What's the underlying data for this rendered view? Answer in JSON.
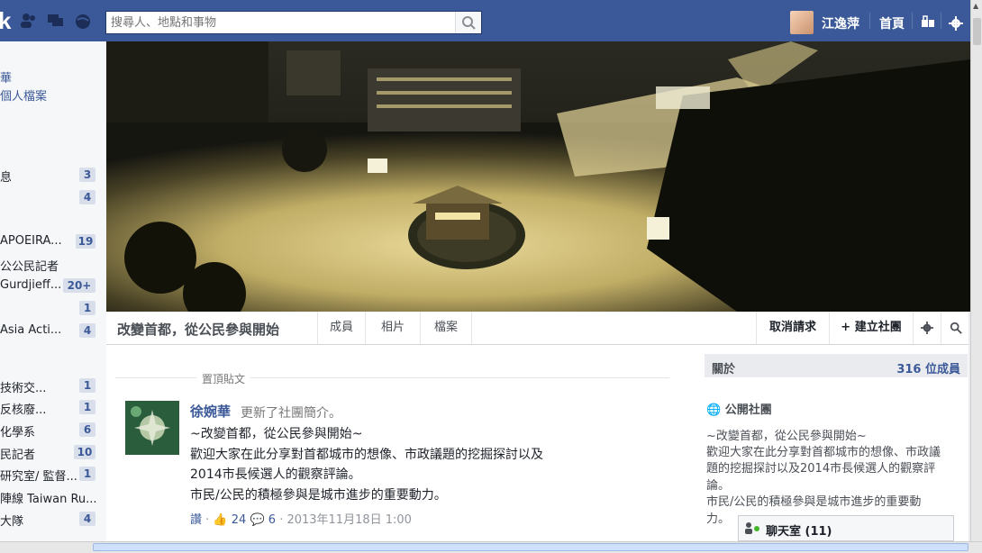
{
  "topbar": {
    "logo": "k",
    "search_placeholder": "搜尋人、地點和事物",
    "user_name": "江逸萍",
    "home_label": "首頁"
  },
  "left_nav": [
    {
      "label": "華",
      "count": ""
    },
    {
      "label": "個人檔案",
      "count": ""
    },
    {
      "label": "息",
      "count": "3"
    },
    {
      "label": "",
      "count": "4"
    },
    {
      "label": "APOEIRA...",
      "count": "19"
    },
    {
      "label": "公公民記者",
      "count": ""
    },
    {
      "label": "Gurdjieff...",
      "count": "20+"
    },
    {
      "label": "",
      "count": "1"
    },
    {
      "label": "Asia Acti...",
      "count": "4"
    },
    {
      "label": "技術交...",
      "count": "1"
    },
    {
      "label": "反核廢...",
      "count": "1"
    },
    {
      "label": "化學系",
      "count": "6"
    },
    {
      "label": "民記者",
      "count": "10"
    },
    {
      "label": "研究室/ 監督...",
      "count": "1"
    },
    {
      "label": "陣線 Taiwan Ru...",
      "count": "1"
    },
    {
      "label": "大隊",
      "count": "4"
    }
  ],
  "group": {
    "name": "改變首都，從公民參與開始",
    "tabs": [
      "成員",
      "相片",
      "檔案"
    ],
    "cancel_request": "取消請求",
    "create_group": "建立社團"
  },
  "post": {
    "pinned_label": "置頂貼文",
    "author": "徐婉華",
    "action": "更新了社團簡介。",
    "lines": [
      "~改變首都，從公民參與開始~",
      "歡迎大家在此分享對首都城市的想像、市政議題的挖掘探討以及",
      "2014市長候選人的觀察評論。",
      "市民/公民的積極參與是城市進步的重要動力。"
    ],
    "read_label": "讚",
    "likes": "24",
    "comments": "6",
    "date": "2013年11月18日 1:00"
  },
  "about": {
    "title": "關於",
    "members": "316 位成員",
    "type": "公開社團",
    "desc_lines": [
      "~改變首都，從公民參與開始~",
      "歡迎大家在此分享對首都城市的想像、市政議",
      "題的挖掘探討以及2014市長候選人的觀察評",
      "論。",
      "市民/公民的積極參與是城市進步的重要動",
      "力。"
    ]
  },
  "chat": {
    "label": "聊天室 (11)"
  }
}
